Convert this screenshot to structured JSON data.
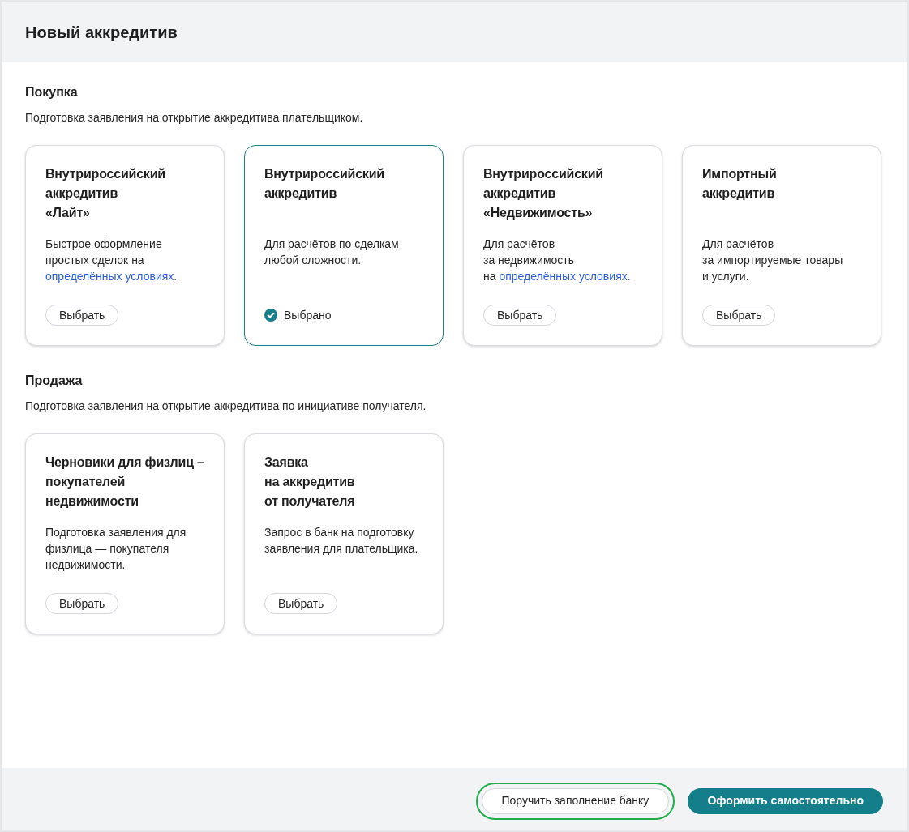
{
  "header": {
    "title": "Новый аккредитив"
  },
  "sections": [
    {
      "title": "Покупка",
      "description": "Подготовка заявления на открытие аккредитива плательщиком.",
      "cards": [
        {
          "title": "Внутрироссийский\nаккредитив\n«Лайт»",
          "description": "Быстрое оформление\nпростых сделок на",
          "link": "определённых условиях.",
          "selected": false,
          "button": "Выбрать"
        },
        {
          "title": "Внутрироссийский\nаккредитив",
          "description": "Для расчётов по сделкам\nлюбой сложности.",
          "selected": true,
          "status": "Выбрано"
        },
        {
          "title": "Внутрироссийский\nаккредитив\n«Недвижимость»",
          "description": "Для расчётов\nза недвижимость\nна",
          "link": "определённых условиях.",
          "selected": false,
          "button": "Выбрать"
        },
        {
          "title": "Импортный\nаккредитив",
          "description": "Для расчётов\nза импортируемые товары\nи услуги.",
          "selected": false,
          "button": "Выбрать"
        }
      ]
    },
    {
      "title": "Продажа",
      "description": "Подготовка заявления на открытие аккредитива по инициативе получателя.",
      "cards": [
        {
          "title": "Черновики для физлиц –\nпокупателей\nнедвижимости",
          "description": "Подготовка заявления для\nфизлица — покупателя\nнедвижимости.",
          "selected": false,
          "button": "Выбрать"
        },
        {
          "title": "Заявка\nна аккредитив\nот получателя",
          "description": "Запрос в банк на подготовку\nзаявления для плательщика.",
          "selected": false,
          "button": "Выбрать"
        }
      ]
    }
  ],
  "footer": {
    "buttons": [
      {
        "label": "Поручить заполнение банку",
        "kind": "secondary",
        "focused": true
      },
      {
        "label": "Оформить самостоятельно",
        "kind": "primary",
        "focused": false
      }
    ]
  }
}
